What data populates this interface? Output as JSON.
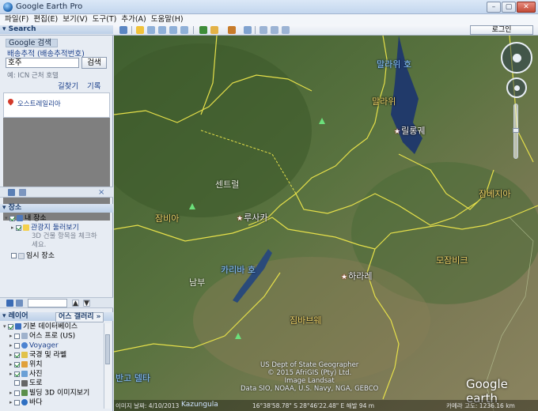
{
  "window": {
    "title": "Google Earth Pro",
    "min": "–",
    "max": "▢",
    "close": "✕"
  },
  "menu": [
    "파일(F)",
    "편집(E)",
    "보기(V)",
    "도구(T)",
    "추가(A)",
    "도움말(H)"
  ],
  "toolbar": {
    "login": "로그인"
  },
  "search": {
    "header": "▾ Search",
    "tab_search": "Google 검색",
    "tab_route": "배송추적 (배송추적번호)",
    "input_value": "호주",
    "button": "검색",
    "example": "예: ICN 근처 호텔",
    "link_directions": "길찾기",
    "link_history": "기록",
    "result": "오스트레일리아"
  },
  "places": {
    "header": "▾ 장소",
    "my_places": "내 장소",
    "sightseeing": "관광지 둘러보기",
    "note_line1": "3D 건물 항목을 체크하",
    "note_line2": "세요.",
    "temp_places": "임시 장소"
  },
  "layers": {
    "header_label": "▾ 레이어",
    "earth_gallery": "어스 갤러리 »",
    "items": [
      {
        "label": "기본 데이터베이스",
        "checked": true
      },
      {
        "label": "어스 프로 (US)",
        "checked": false
      },
      {
        "label": "Voyager",
        "checked": false
      },
      {
        "label": "국경 및 라벨",
        "checked": true
      },
      {
        "label": "위치",
        "checked": true
      },
      {
        "label": "사진",
        "checked": true
      },
      {
        "label": "도로",
        "checked": false
      },
      {
        "label": "빌딩 3D 이미지보기",
        "checked": false
      },
      {
        "label": "바다",
        "checked": false
      }
    ]
  },
  "map": {
    "countries": [
      "말라위",
      "잠비아",
      "짐바브웨",
      "모잠비크",
      "잠베지아"
    ],
    "cities": [
      "릴롱궤",
      "루사카",
      "하라레"
    ],
    "waters": [
      "말라위 호",
      "카리바 호",
      "반고 델타"
    ],
    "regions": [
      "센트럴",
      "남부"
    ],
    "credits": [
      "US Dept of State Geographer",
      "© 2015 AfriGIS (Pty) Ltd.",
      "Image Landsat",
      "Data SIO, NOAA, U.S. Navy, NGA, GEBCO"
    ],
    "logo": "Google earth",
    "status_date": "이미지 날짜: 4/10/2013",
    "status_label": "Kazungula",
    "status_coords": "16°38'58.78\" S  28°46'22.48\" E  해발  94 m",
    "status_eye": "카메라 고도: 1236.16 km"
  }
}
